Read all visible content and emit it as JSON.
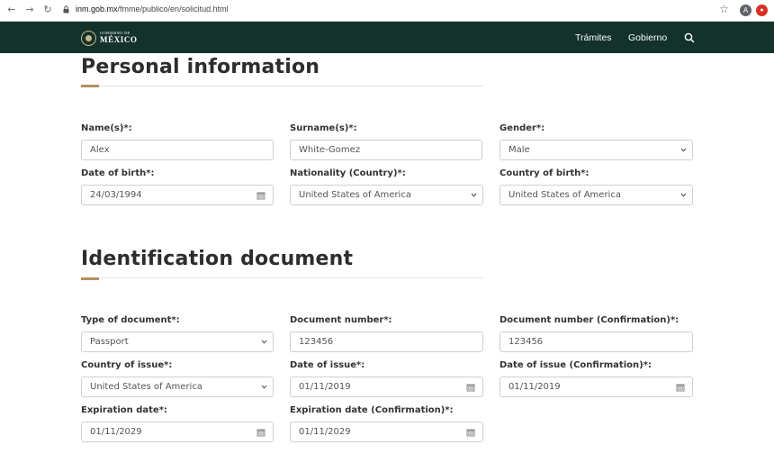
{
  "browser": {
    "url_host": "inm.gob.mx",
    "url_path": "/fmme/publico/en/solicitud.html",
    "avatar_letter": "A"
  },
  "header": {
    "logo_small": "GOBIERNO DE",
    "logo_big": "MÉXICO",
    "nav": [
      "Trámites",
      "Gobierno"
    ]
  },
  "personal": {
    "title": "Personal information",
    "fields": {
      "names": {
        "label": "Name(s)*:",
        "value": "Alex"
      },
      "surnames": {
        "label": "Surname(s)*:",
        "value": "White-Gomez"
      },
      "gender": {
        "label": "Gender*:",
        "value": "Male"
      },
      "dob": {
        "label": "Date of birth*:",
        "value": "24/03/1994"
      },
      "nationality": {
        "label": "Nationality (Country)*:",
        "value": "United States of America"
      },
      "country_birth": {
        "label": "Country of birth*:",
        "value": "United States of America"
      }
    }
  },
  "identification": {
    "title": "Identification document",
    "fields": {
      "doc_type": {
        "label": "Type of document*:",
        "value": "Passport"
      },
      "doc_number": {
        "label": "Document number*:",
        "value": "123456"
      },
      "doc_number_confirm": {
        "label": "Document number (Confirmation)*:",
        "value": "123456"
      },
      "country_issue": {
        "label": "Country of issue*:",
        "value": "United States of America"
      },
      "date_issue": {
        "label": "Date of issue*:",
        "value": "01/11/2019"
      },
      "date_issue_confirm": {
        "label": "Date of issue (Confirmation)*:",
        "value": "01/11/2019"
      },
      "expiration": {
        "label": "Expiration date*:",
        "value": "01/11/2029"
      },
      "expiration_confirm": {
        "label": "Expiration date (Confirmation)*:",
        "value": "01/11/2029"
      }
    }
  },
  "colors": {
    "header_bg": "#13322b",
    "accent": "#b38e5d"
  }
}
